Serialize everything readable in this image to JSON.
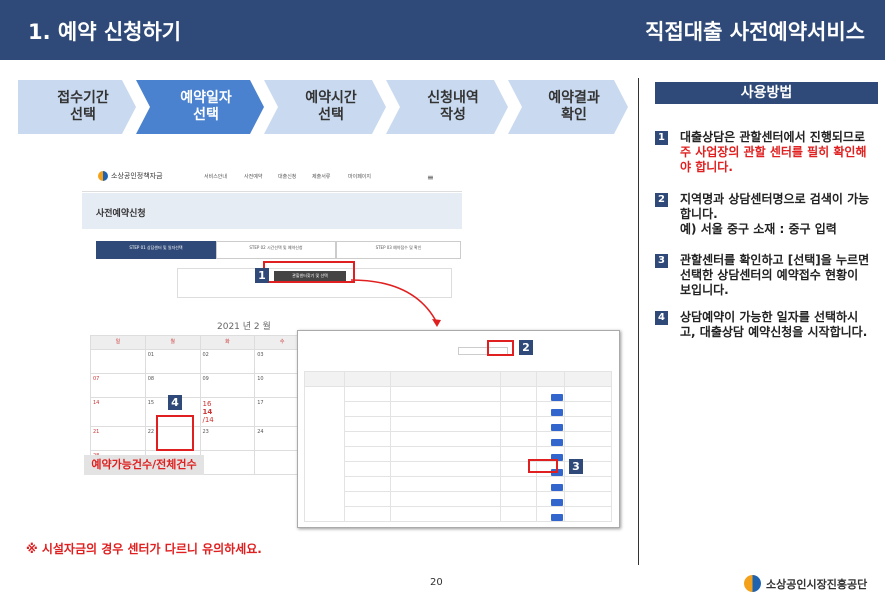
{
  "header": {
    "title_left": "1. 예약 신청하기",
    "title_right": "직접대출 사전예약서비스"
  },
  "steps": [
    "접수기간\n선택",
    "예약일자\n선택",
    "예약시간\n선택",
    "신청내역\n작성",
    "예약결과\n확인"
  ],
  "howto": {
    "title": "사용방법"
  },
  "tips": [
    {
      "n": "1",
      "a": "대출상담은 관할센터에서 진행되므로 ",
      "red": "주 사업장의 관할 센터를 필히 확인해야 합니다.",
      "b": ""
    },
    {
      "n": "2",
      "a": "지역명과 상담센터명으로 검색이 가능합니다.",
      "red": "",
      "b": "예) 서울 중구 소재 : 중구 입력"
    },
    {
      "n": "3",
      "a": "관할센터를 확인하고 [선택]을 누르면 선택한 상담센터의 예약접수 현황이 보입니다.",
      "red": "",
      "b": ""
    },
    {
      "n": "4",
      "a": "상담예약이 가능한 일자를 선택하시고, 대출상담 예약신청을 시작합니다.",
      "red": "",
      "b": ""
    }
  ],
  "shot": {
    "logo": "소상공인정책자금",
    "menu": [
      "서비스안내",
      "사전예약",
      "대출신청",
      "제출서류",
      "마이페이지"
    ],
    "page_title": "사전예약신청",
    "tabs": [
      "STEP 01 상담센터 및 일자선택",
      "STEP 02 시간선택 및 예약신청",
      "STEP 03 예약접수 및 확인"
    ],
    "search_btn": "관할센터찾기 및 선택",
    "month": "2021 년 2 월",
    "days": [
      "일",
      "월",
      "화",
      "수"
    ],
    "rows": [
      [
        "",
        "01",
        "02",
        "03"
      ],
      [
        "07",
        "08",
        "09",
        "10"
      ],
      [
        "14",
        "15",
        "16",
        "17"
      ],
      [
        "21",
        "22",
        "23",
        "24"
      ],
      [
        "28",
        "",
        "",
        ""
      ]
    ],
    "highlight_count": "14",
    "highlight_total": "/14"
  },
  "markers": [
    "1",
    "2",
    "3",
    "4"
  ],
  "pill": "예약가능건수/전체건수",
  "note": "※ 시설자금의 경우 센터가 다르니 유의하세요.",
  "page_number": "20",
  "brand": "소상공인시장진흥공단",
  "colors": {
    "primary": "#2f4a78",
    "accent": "#e02020",
    "step": "#c9daf0",
    "step_active": "#4a82cf"
  }
}
